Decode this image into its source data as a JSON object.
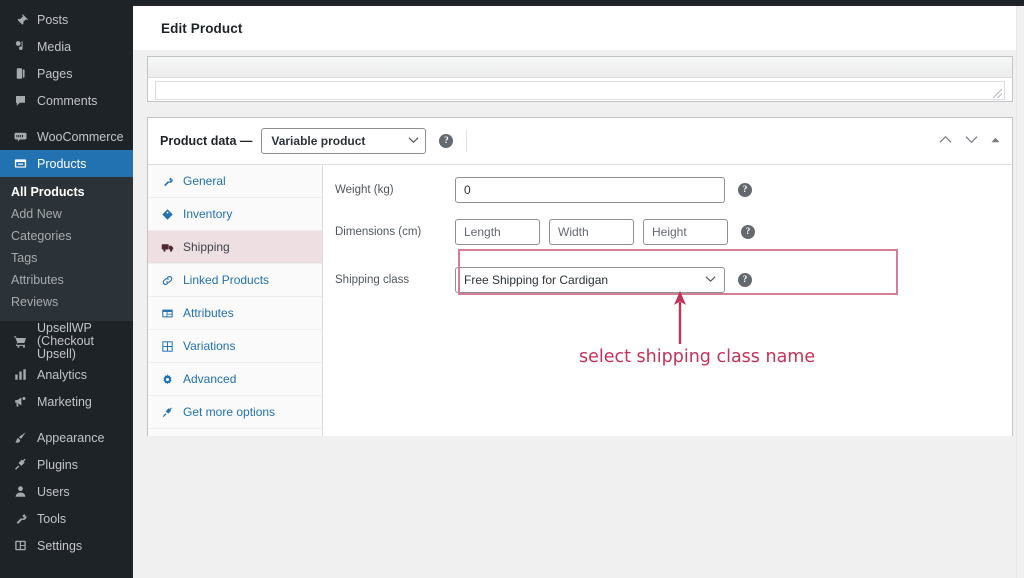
{
  "page": {
    "title": "Edit Product"
  },
  "sidebar": {
    "items": [
      {
        "label": "Posts",
        "icon": "pin-icon",
        "current": false
      },
      {
        "label": "Media",
        "icon": "media-icon",
        "current": false
      },
      {
        "label": "Pages",
        "icon": "pages-icon",
        "current": false
      },
      {
        "label": "Comments",
        "icon": "comments-icon",
        "current": false
      },
      {
        "label": "WooCommerce",
        "icon": "woocommerce-icon",
        "current": false
      },
      {
        "label": "Products",
        "icon": "products-icon",
        "current": true
      }
    ],
    "submenu": [
      {
        "label": "All Products",
        "current": true
      },
      {
        "label": "Add New",
        "current": false
      },
      {
        "label": "Categories",
        "current": false
      },
      {
        "label": "Tags",
        "current": false
      },
      {
        "label": "Attributes",
        "current": false
      },
      {
        "label": "Reviews",
        "current": false
      }
    ],
    "items_after": [
      {
        "label": "UpsellWP (Checkout Upsell)",
        "icon": "cart-icon",
        "two_line": true
      },
      {
        "label": "Analytics",
        "icon": "analytics-icon",
        "two_line": false
      },
      {
        "label": "Marketing",
        "icon": "megaphone-icon",
        "two_line": false
      },
      {
        "label": "Appearance",
        "icon": "brush-icon",
        "two_line": false
      },
      {
        "label": "Plugins",
        "icon": "plugin-icon",
        "two_line": false
      },
      {
        "label": "Users",
        "icon": "users-icon",
        "two_line": false
      },
      {
        "label": "Tools",
        "icon": "tools-icon",
        "two_line": false
      },
      {
        "label": "Settings",
        "icon": "settings-icon",
        "two_line": false
      }
    ]
  },
  "metabox": {
    "heading": "Product data —",
    "product_type": "Variable product",
    "help_icon": "help-icon",
    "controls": {
      "move_up": "move-up-icon",
      "move_down": "move-down-icon",
      "toggle": "toggle-panel-icon"
    },
    "tabs": [
      {
        "label": "General",
        "icon": "wrench-icon",
        "active": false
      },
      {
        "label": "Inventory",
        "icon": "tag-icon",
        "active": false
      },
      {
        "label": "Shipping",
        "icon": "truck-icon",
        "active": true
      },
      {
        "label": "Linked Products",
        "icon": "link-icon",
        "active": false
      },
      {
        "label": "Attributes",
        "icon": "table-icon",
        "active": false
      },
      {
        "label": "Variations",
        "icon": "grid-icon",
        "active": false
      },
      {
        "label": "Advanced",
        "icon": "gear-icon",
        "active": false
      },
      {
        "label": "Get more options",
        "icon": "plug-icon",
        "active": false
      }
    ],
    "fields": {
      "weight": {
        "label": "Weight (kg)",
        "value": "0",
        "placeholder": "0"
      },
      "dimensions": {
        "label": "Dimensions (cm)",
        "length_placeholder": "Length",
        "width_placeholder": "Width",
        "height_placeholder": "Height"
      },
      "shipping_class": {
        "label": "Shipping class",
        "value": "Free Shipping for Cardigan"
      }
    }
  },
  "annotation": {
    "text": "select shipping class name",
    "color": "#c4325a",
    "highlight_color": "#d27e95"
  }
}
